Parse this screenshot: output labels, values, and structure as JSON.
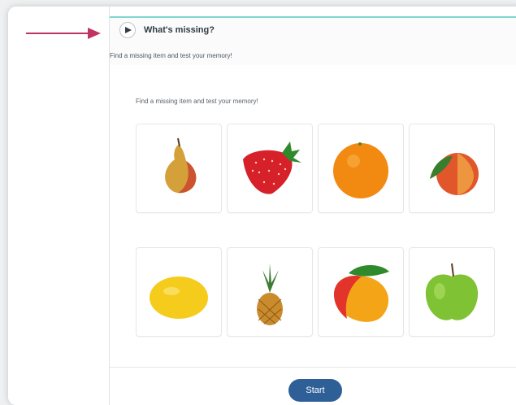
{
  "header": {
    "title": "What's missing?"
  },
  "subtitle": "Find a missing item and test your memory!",
  "instructions": "Find a missing item and test your memory!",
  "items": [
    {
      "name": "pear"
    },
    {
      "name": "strawberry"
    },
    {
      "name": "orange"
    },
    {
      "name": "peach"
    },
    {
      "name": "lemon"
    },
    {
      "name": "pineapple"
    },
    {
      "name": "mango"
    },
    {
      "name": "green-apple"
    }
  ],
  "start_label": "Start",
  "colors": {
    "accent_line": "#7fd6cf",
    "start_button": "#2f5f97",
    "arrow": "#c03464"
  }
}
